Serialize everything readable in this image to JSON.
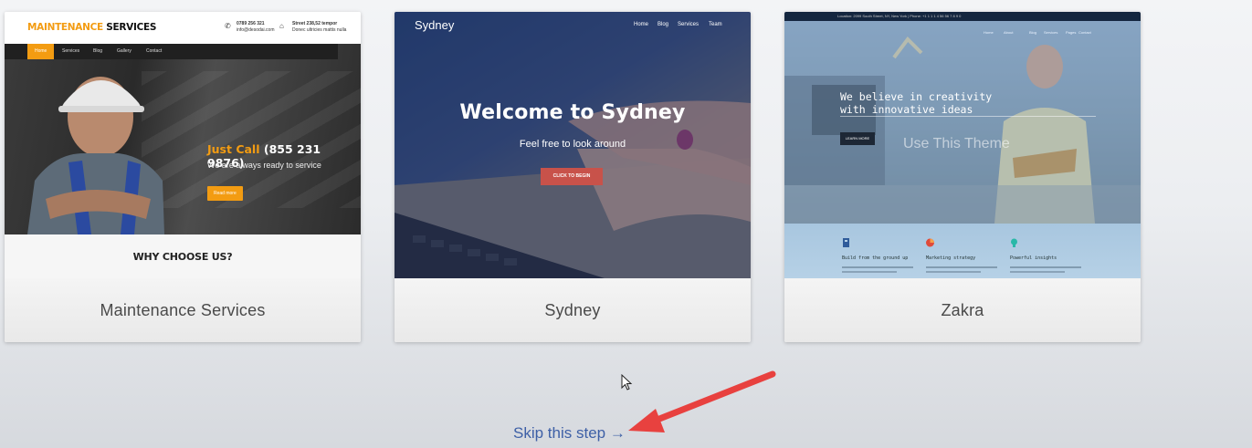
{
  "themes": [
    {
      "name": "Maintenance Services",
      "preview": {
        "logo_part1": "MAINTENANCE",
        "logo_part2": "SERVICES",
        "phone": "0789 256 321",
        "email": "info@desodai.com",
        "address_line1": "Street 238,52 tempor",
        "address_line2": "Donec ultricies mattis nulla",
        "nav": [
          "Home",
          "Services",
          "Blog",
          "Gallery",
          "Contact"
        ],
        "call_label": "Just Call",
        "call_number": "(855 231 9876)",
        "tagline": "We are always ready to service",
        "button": "Read more",
        "section_title": "WHY CHOOSE US?"
      }
    },
    {
      "name": "Sydney",
      "preview": {
        "logo": "Sydney",
        "nav": [
          "Home",
          "Blog",
          "Services",
          "Team"
        ],
        "headline": "Welcome to Sydney",
        "subline": "Feel free to look around",
        "button": "CLICK TO BEGIN"
      }
    },
    {
      "name": "Zakra",
      "preview": {
        "topbar": "Location: 2099 South Street, NY, New York | Phone: +1 1 1 1 4 56 56 7 8 9 0",
        "nav": [
          "Home",
          "About",
          "Blog",
          "Services",
          "Pages",
          "Contact"
        ],
        "headline_line1": "We believe in creativity",
        "headline_line2": "with innovative ideas",
        "button": "LEARN MORE",
        "watermark": "Use This Theme",
        "features": [
          "Build from the ground up",
          "Marketing strategy",
          "Powerful insights"
        ]
      }
    }
  ],
  "skip_link": "Skip this step →",
  "colors": {
    "accent_orange": "#f39c12",
    "sydney_button": "#c8524a",
    "link_blue": "#3d5fa6",
    "annotation_arrow": "#e8413f"
  }
}
